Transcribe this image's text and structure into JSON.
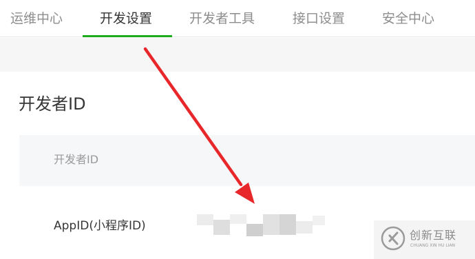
{
  "tabs": [
    {
      "label": "运维中心",
      "active": false
    },
    {
      "label": "开发设置",
      "active": true
    },
    {
      "label": "开发者工具",
      "active": false
    },
    {
      "label": "接口设置",
      "active": false
    },
    {
      "label": "安全中心",
      "active": false
    }
  ],
  "section": {
    "title": "开发者ID",
    "table_header": "开发者ID",
    "rows": [
      {
        "label": "AppID(小程序ID)",
        "value_obscured": true
      }
    ]
  },
  "watermark": {
    "brand_cn": "创新互联",
    "brand_en": "CHUANG XIN HU LIAN"
  },
  "colors": {
    "accent": "#1aad19",
    "annotation_arrow": "#e8272a"
  },
  "icons": [
    "annotation-arrow",
    "brand-logo-icon"
  ]
}
